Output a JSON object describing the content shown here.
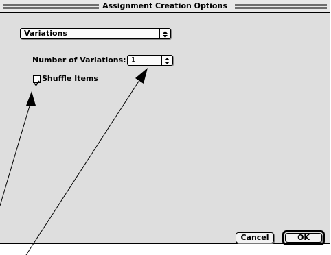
{
  "window": {
    "title": "Assignment Creation Options"
  },
  "panel_selector": {
    "selected": "Variations",
    "icon": "updown-arrows-icon"
  },
  "variations": {
    "label": "Number of Variations:",
    "value": "1"
  },
  "shuffle": {
    "label": "Shuffle Items",
    "checked": true
  },
  "buttons": {
    "cancel": "Cancel",
    "ok": "OK"
  }
}
